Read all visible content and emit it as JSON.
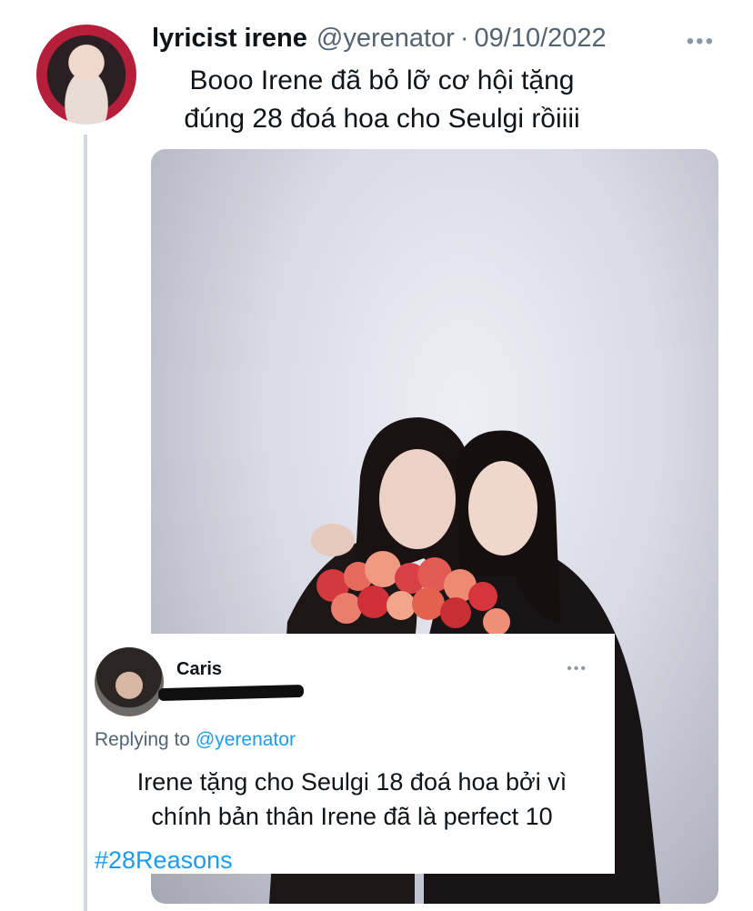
{
  "tweet": {
    "display_name": "lyricist irene",
    "handle": "@yerenator",
    "separator": "·",
    "date": "09/10/2022",
    "more_label": "•••",
    "text_line1": "Booo Irene đã bỏ lỡ cơ hội tặng",
    "text_line2": "đúng 28 đoá hoa cho Seulgi rồiiii"
  },
  "reply": {
    "display_name": "Caris",
    "more_label": "•••",
    "replying_prefix": "Replying to",
    "replying_handle": "@yerenator",
    "text_line1": "Irene tặng cho Seulgi 18 đoá hoa bởi vì",
    "text_line2": "chính bản thân Irene đã là perfect 10",
    "hashtag": "#28Reasons"
  },
  "colors": {
    "link": "#1d9bf0",
    "secondary_text": "#536471",
    "thread_line": "#cfd9de"
  }
}
